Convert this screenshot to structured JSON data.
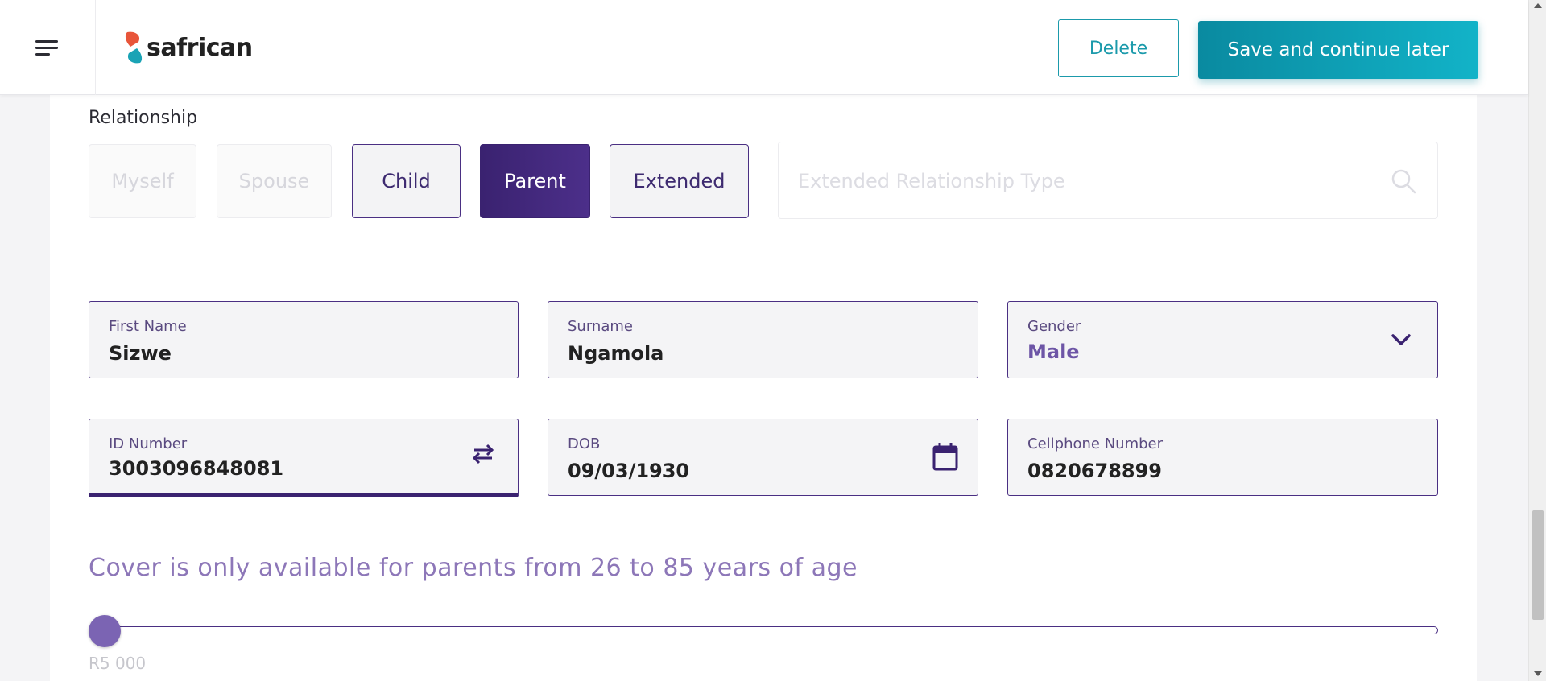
{
  "header": {
    "brand": "safrican",
    "delete_label": "Delete",
    "save_label": "Save and continue later",
    "accent_color": "#12a6b9"
  },
  "relationship": {
    "label": "Relationship",
    "options": [
      {
        "label": "Myself",
        "state": "disabled"
      },
      {
        "label": "Spouse",
        "state": "disabled"
      },
      {
        "label": "Child",
        "state": "enabled"
      },
      {
        "label": "Parent",
        "state": "selected"
      },
      {
        "label": "Extended",
        "state": "enabled"
      }
    ],
    "extended_placeholder": "Extended Relationship Type",
    "selected_color": "#3a2270"
  },
  "fields": {
    "first_name": {
      "label": "First Name",
      "value": "Sizwe"
    },
    "surname": {
      "label": "Surname",
      "value": "Ngamola"
    },
    "gender": {
      "label": "Gender",
      "value": "Male"
    },
    "id_number": {
      "label": "ID Number",
      "value": "3003096848081"
    },
    "dob": {
      "label": "DOB",
      "value": "09/03/1930"
    },
    "cellphone": {
      "label": "Cellphone Number",
      "value": "0820678899"
    }
  },
  "cover": {
    "message": "Cover is only available for parents from 26 to 85 years of age",
    "amount": "R5 000",
    "slider_fraction": 0.0
  }
}
